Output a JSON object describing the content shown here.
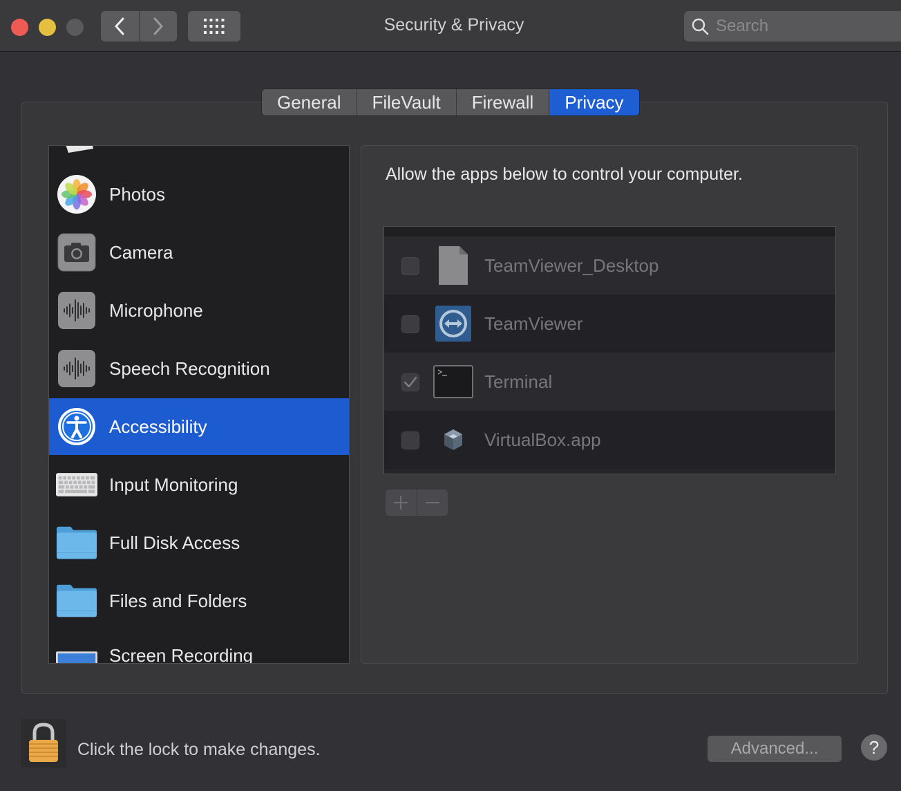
{
  "window": {
    "title": "Security & Privacy",
    "search_placeholder": "Search"
  },
  "tabs": [
    {
      "label": "General",
      "active": false
    },
    {
      "label": "FileVault",
      "active": false
    },
    {
      "label": "Firewall",
      "active": false
    },
    {
      "label": "Privacy",
      "active": true
    }
  ],
  "sidebar": {
    "items": [
      {
        "label": "Photos",
        "icon": "photos-icon"
      },
      {
        "label": "Camera",
        "icon": "camera-icon"
      },
      {
        "label": "Microphone",
        "icon": "microphone-waveform-icon"
      },
      {
        "label": "Speech Recognition",
        "icon": "speech-waveform-icon"
      },
      {
        "label": "Accessibility",
        "icon": "accessibility-icon",
        "selected": true
      },
      {
        "label": "Input Monitoring",
        "icon": "keyboard-icon"
      },
      {
        "label": "Full Disk Access",
        "icon": "folder-icon"
      },
      {
        "label": "Files and Folders",
        "icon": "folder-icon"
      },
      {
        "label": "Screen Recording",
        "icon": "screen-icon"
      }
    ]
  },
  "main": {
    "description": "Allow the apps below to control your computer.",
    "apps": [
      {
        "name": "TeamViewer_Desktop",
        "checked": false,
        "icon": "document-icon"
      },
      {
        "name": "TeamViewer",
        "checked": false,
        "icon": "teamviewer-icon"
      },
      {
        "name": "Terminal",
        "checked": true,
        "icon": "terminal-icon"
      },
      {
        "name": "VirtualBox.app",
        "checked": false,
        "icon": "virtualbox-icon"
      }
    ],
    "add_label": "+",
    "remove_label": "−"
  },
  "footer": {
    "lock_text": "Click the lock to make changes.",
    "advanced_label": "Advanced...",
    "help_label": "?"
  },
  "colors": {
    "accent": "#1d5fd2",
    "close": "#ee5b55",
    "minimize": "#e5bf3f",
    "zoom": "#5a5a5d"
  }
}
